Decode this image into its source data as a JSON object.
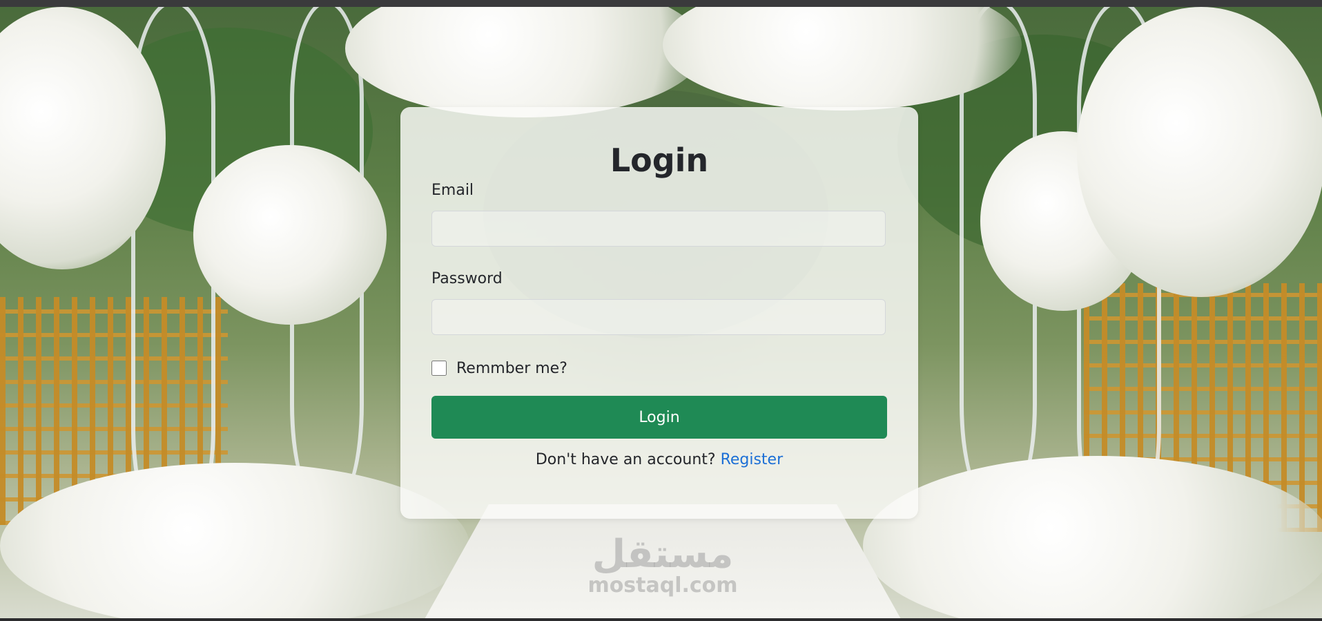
{
  "watermark": {
    "logo_text": "مستقل",
    "domain": "mostaql.com"
  },
  "login_form": {
    "title": "Login",
    "email": {
      "label": "Email",
      "value": "",
      "placeholder": ""
    },
    "password": {
      "label": "Password",
      "value": "",
      "placeholder": ""
    },
    "remember_me": {
      "label": "Remmber me?",
      "checked": false
    },
    "submit_label": "Login",
    "register_prompt": "Don't have an account?",
    "register_link": "Register"
  },
  "colors": {
    "primary_button": "#1f8a55",
    "link": "#1c6fd6",
    "text": "#24262b"
  }
}
